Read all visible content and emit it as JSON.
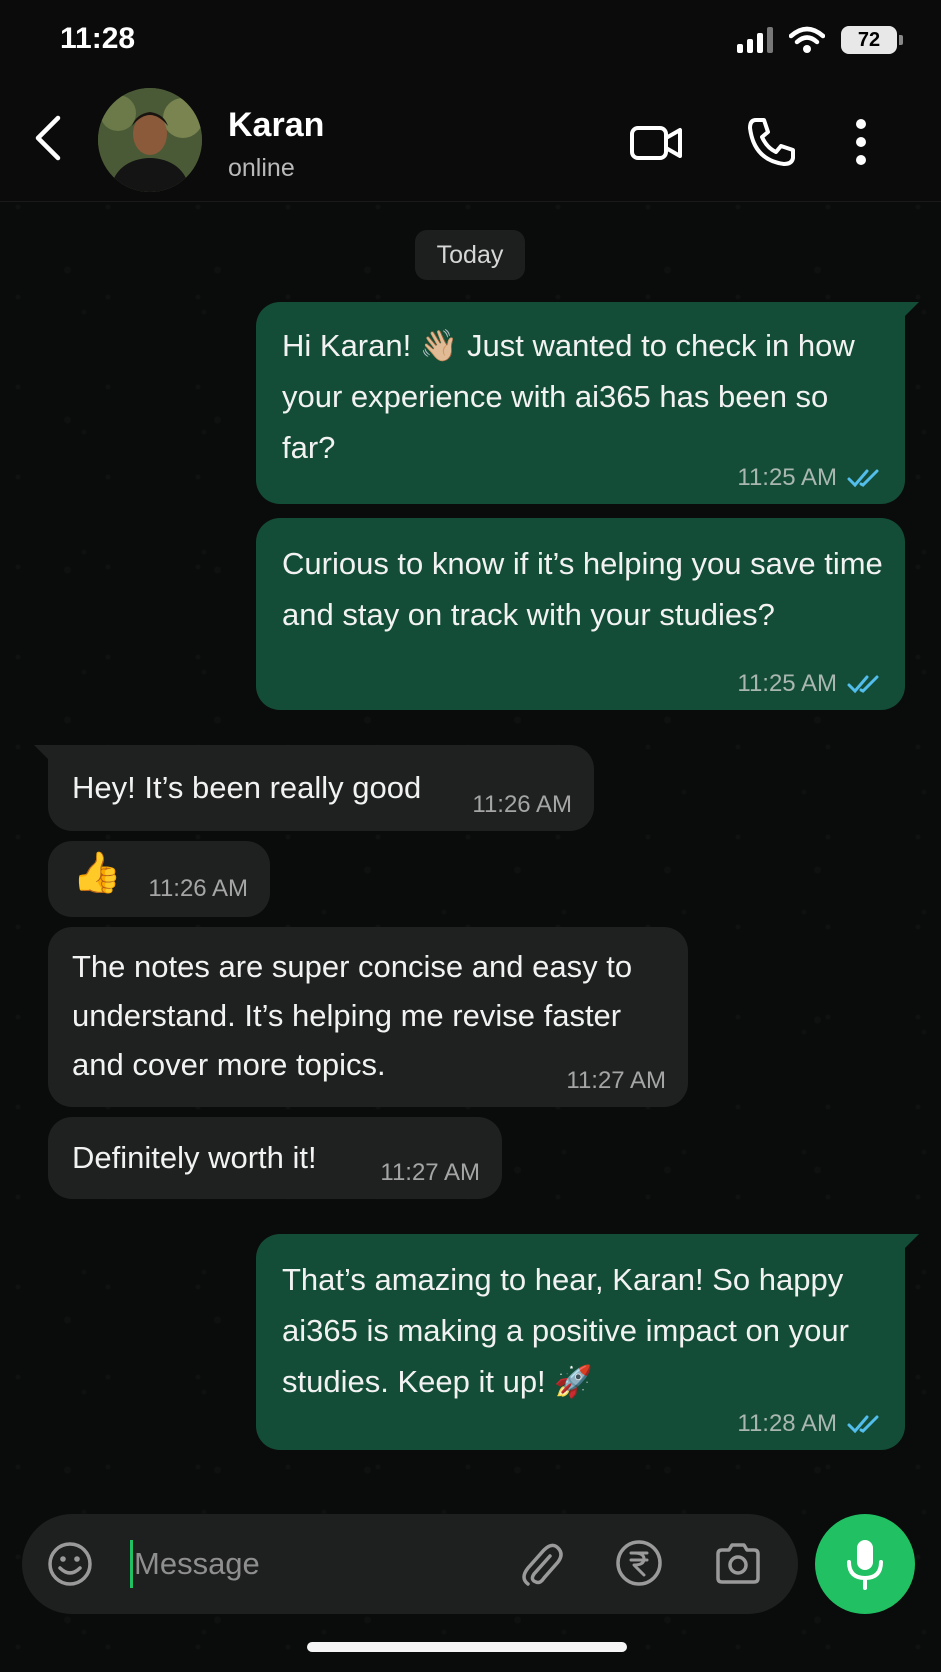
{
  "status_bar": {
    "time": "11:28",
    "battery": "72"
  },
  "header": {
    "name": "Karan",
    "status": "online"
  },
  "date_divider": "Today",
  "messages": [
    {
      "dir": "out",
      "text": "Hi Karan! 👋🏼 Just wanted to check in how your experience with ai365 has been so far?",
      "time": "11:25 AM",
      "read": true
    },
    {
      "dir": "out",
      "text": "Curious to know if it’s helping you save time and stay on track with your studies?",
      "time": "11:25 AM",
      "read": true
    },
    {
      "dir": "in",
      "text": "Hey! It’s been really good",
      "time": "11:26 AM"
    },
    {
      "dir": "in",
      "text": "👍",
      "time": "11:26 AM"
    },
    {
      "dir": "in",
      "text": "The notes are super concise and easy to understand. It’s helping me revise faster and cover more topics.",
      "time": "11:27 AM"
    },
    {
      "dir": "in",
      "text": "Definitely worth it!",
      "time": "11:27 AM"
    },
    {
      "dir": "out",
      "text": "That’s amazing to hear, Karan! So happy ai365 is making a positive impact on your studies. Keep it up! 🚀",
      "time": "11:28 AM",
      "read": true
    }
  ],
  "composer": {
    "placeholder": "Message"
  },
  "colors": {
    "outgoing": "#134d37",
    "incoming": "#1f2121",
    "accent": "#21c063",
    "read_ticks": "#53bdeb"
  },
  "icons": [
    "back-arrow-icon",
    "video-call-icon",
    "phone-icon",
    "more-vertical-icon",
    "emoji-icon",
    "paperclip-icon",
    "rupee-icon",
    "camera-icon",
    "microphone-icon",
    "double-check-icon"
  ]
}
